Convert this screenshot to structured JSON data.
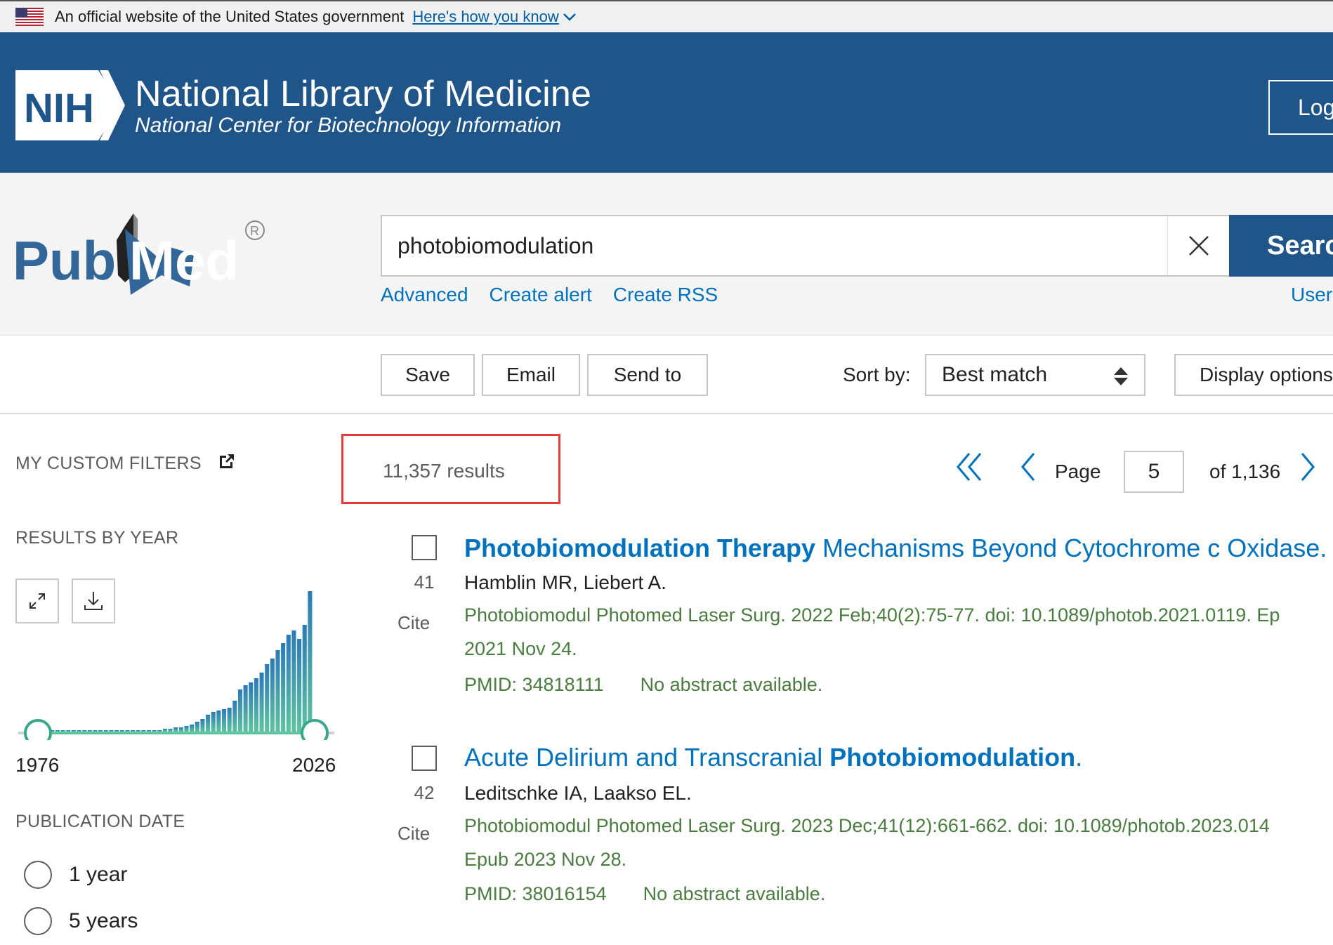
{
  "gov_banner": {
    "text": "An official website of the United States government",
    "link": "Here's how you know"
  },
  "nih_header": {
    "logo_text": "NIH",
    "title": "National Library of Medicine",
    "subtitle": "National Center for Biotechnology Information",
    "login_label": "Log"
  },
  "search": {
    "logo_text_left": "Pub",
    "logo_text_right": "Med",
    "query": "photobiomodulation",
    "button_label": "Searc",
    "links": [
      "Advanced",
      "Create alert",
      "Create RSS"
    ],
    "user_guide": "User"
  },
  "toolbar": {
    "save_label": "Save",
    "email_label": "Email",
    "send_to_label": "Send to",
    "sort_label": "Sort by:",
    "sort_value": "Best match",
    "display_label": "Display options"
  },
  "sidebar": {
    "custom_filters": "MY CUSTOM FILTERS",
    "results_by_year": "RESULTS BY YEAR",
    "year_start": "1976",
    "year_end": "2026",
    "publication_date": "PUBLICATION DATE",
    "date_options": [
      "1 year",
      "5 years"
    ]
  },
  "results": {
    "count": "11,357 results",
    "page_label": "Page",
    "page_value": "5",
    "page_of": "of 1,136",
    "items": [
      {
        "num": "41",
        "cite": "Cite",
        "title_bold": "Photobiomodulation Therapy",
        "title_rest": " Mechanisms Beyond Cytochrome c Oxidase.",
        "authors": "Hamblin MR, Liebert A.",
        "citation_line1": "Photobiomodul Photomed Laser Surg. 2022 Feb;40(2):75-77. doi: 10.1089/photob.2021.0119. Ep",
        "citation_line2": "2021 Nov 24.",
        "pmid": "PMID: 34818111",
        "abstract": "No abstract available."
      },
      {
        "num": "42",
        "cite": "Cite",
        "title_rest": "Acute Delirium and Transcranial ",
        "title_bold": "Photobiomodulation",
        "title_end": ".",
        "authors": "Leditschke IA, Laakso EL.",
        "citation_line1": "Photobiomodul Photomed Laser Surg. 2023 Dec;41(12):661-662. doi: 10.1089/photob.2023.014",
        "citation_line2": "Epub 2023 Nov 28.",
        "pmid": "PMID: 38016154",
        "abstract": "No abstract available."
      }
    ]
  },
  "colors": {
    "nih_blue": "#20558a",
    "link_blue": "#0071bc",
    "citation_green": "#4a7c3f",
    "highlight_red": "#e53b3b"
  },
  "chart_data": {
    "type": "bar",
    "x_range": [
      1976,
      2026
    ],
    "values": [
      1,
      1,
      1,
      1,
      1,
      1,
      1,
      1,
      1,
      1,
      1,
      1,
      1,
      1,
      1,
      1,
      1,
      1,
      1,
      1,
      1,
      1,
      1,
      2,
      2,
      3,
      3,
      4,
      5,
      7,
      9,
      12,
      14,
      15,
      16,
      17,
      22,
      30,
      33,
      35,
      38,
      42,
      48,
      52,
      58,
      63,
      69,
      72,
      66,
      76,
      100
    ]
  }
}
